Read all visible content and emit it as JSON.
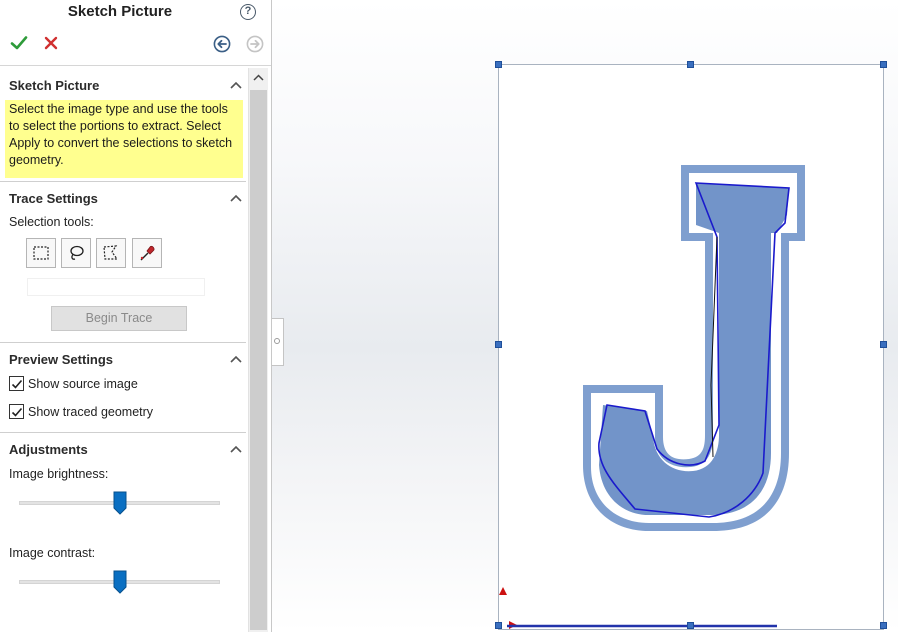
{
  "panel": {
    "title": "Sketch Picture",
    "header_icons": [
      "help-icon",
      "ok-checkmark-icon",
      "cancel-x-icon",
      "back-arrow-icon",
      "forward-arrow-icon"
    ]
  },
  "sections": {
    "sketch_picture": {
      "title": "Sketch Picture",
      "message": "Select the image type and use the tools to select the portions to extract. Select Apply to convert the selections to sketch geometry."
    },
    "trace_settings": {
      "title": "Trace Settings",
      "selection_tools_label": "Selection tools:",
      "tools": [
        "rectangle-select-icon",
        "lasso-select-icon",
        "polygon-select-icon",
        "color-picker-icon"
      ],
      "begin_trace_label": "Begin Trace"
    },
    "preview_settings": {
      "title": "Preview Settings",
      "show_source_label": "Show source image",
      "show_source_checked": true,
      "show_traced_label": "Show traced geometry",
      "show_traced_checked": true
    },
    "adjustments": {
      "title": "Adjustments",
      "brightness_label": "Image brightness:",
      "brightness_value": 0.5,
      "contrast_label": "Image contrast:",
      "contrast_value": 0.5
    }
  },
  "colors": {
    "accent": "#0a6fc2",
    "message_bg": "#ffff8f",
    "ok_green": "#2e9b3a",
    "cancel_red": "#d03030",
    "letter_fill": "#7294c9",
    "letter_outline": "#7f9fcf",
    "trace_line": "#1a1acc"
  }
}
